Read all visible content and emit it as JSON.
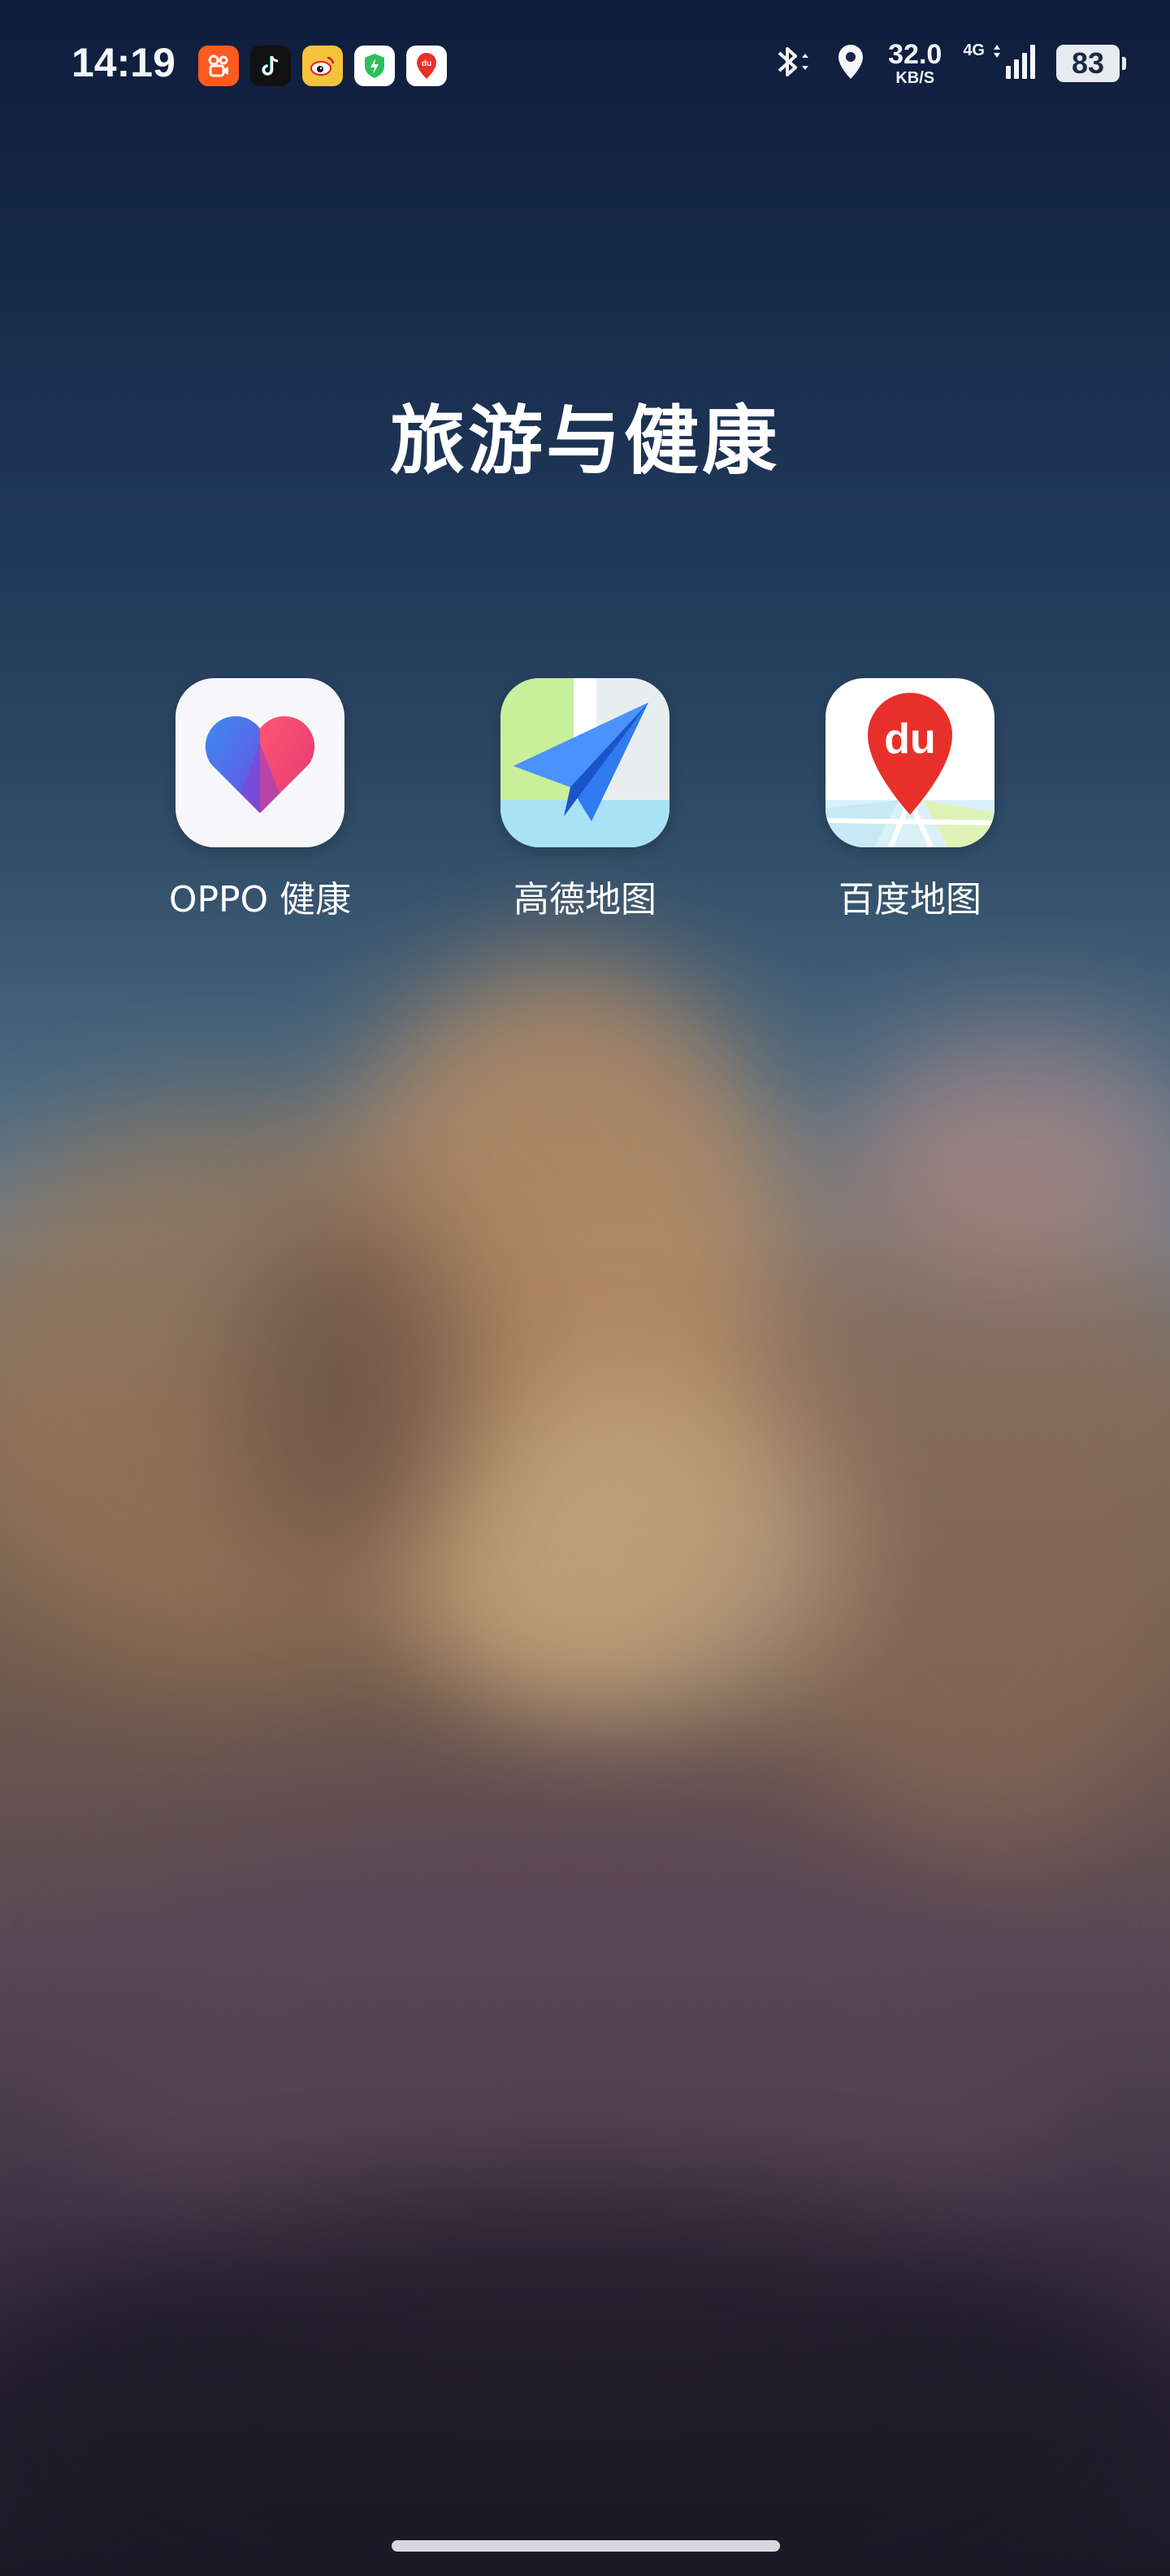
{
  "status_bar": {
    "time": "14:19",
    "notification_icons": [
      {
        "name": "kuaishou-icon",
        "color": "#ff5a1f"
      },
      {
        "name": "douyin-icon",
        "color": "#111111"
      },
      {
        "name": "weibo-icon",
        "color": "#f5c33b"
      },
      {
        "name": "security-shield-icon",
        "color": "#ffffff"
      },
      {
        "name": "baidu-map-icon",
        "color": "#ffffff"
      }
    ],
    "network_speed": "32.0",
    "network_speed_unit": "KB/S",
    "network_type": "4G",
    "battery": "83"
  },
  "folder": {
    "title": "旅游与健康",
    "apps": [
      {
        "label": "OPPO 健康",
        "icon": "heart-icon"
      },
      {
        "label": "高德地图",
        "icon": "paper-plane-icon"
      },
      {
        "label": "百度地图",
        "icon": "map-pin-icon",
        "icon_text": "du"
      }
    ]
  }
}
